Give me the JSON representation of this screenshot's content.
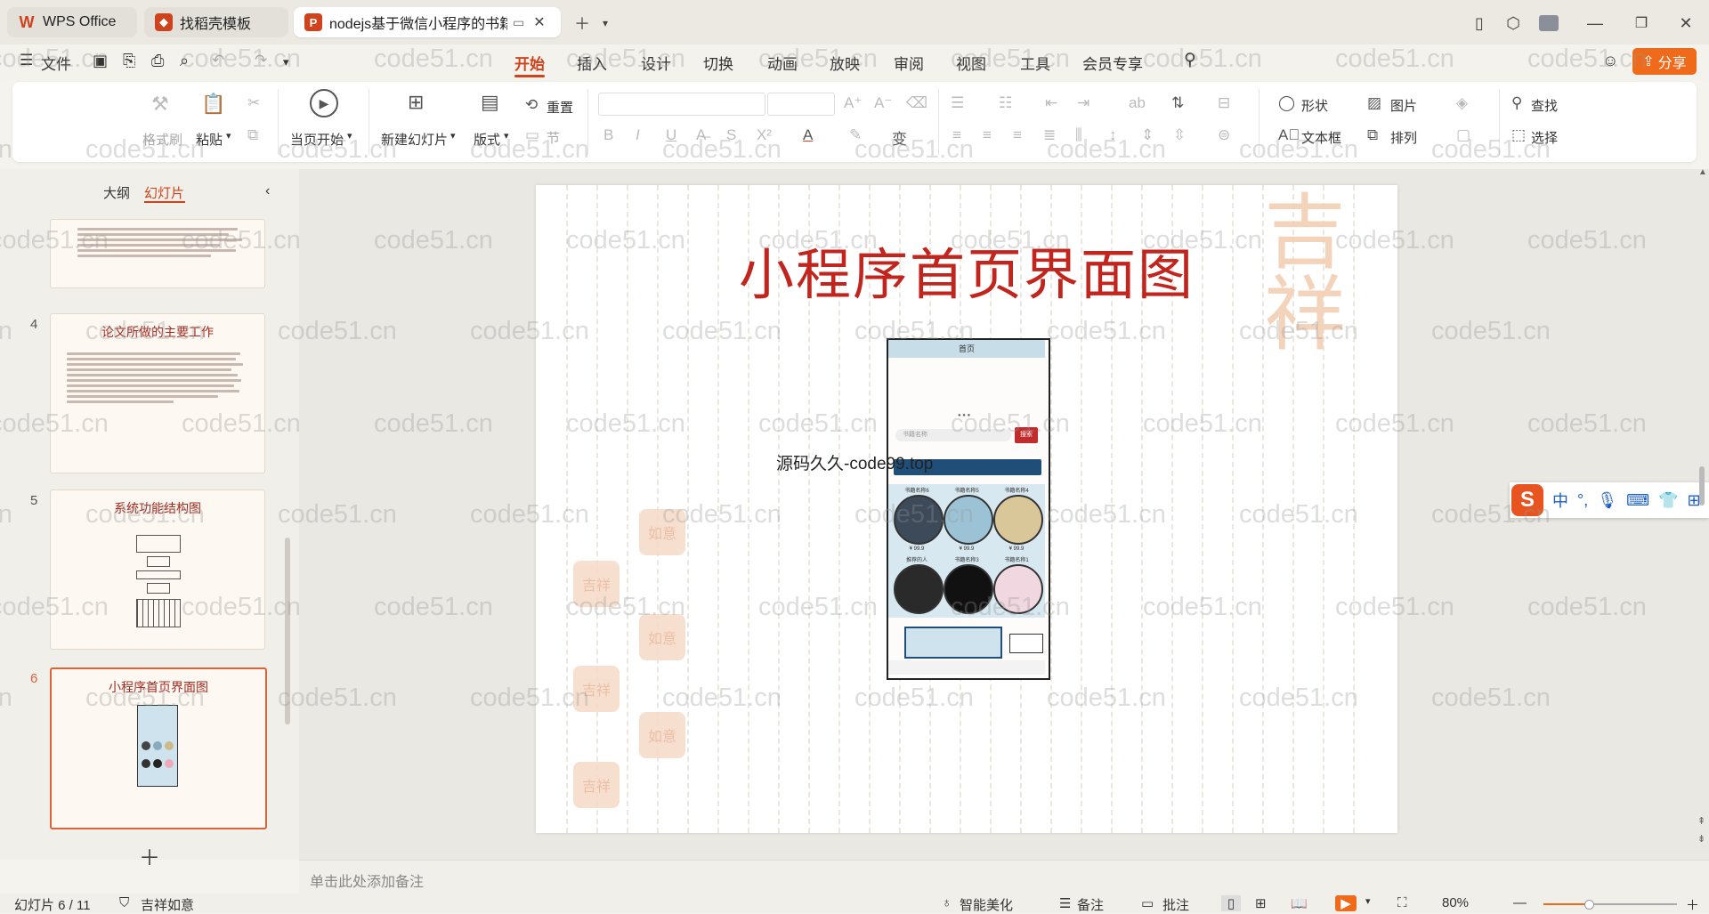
{
  "tabs": [
    {
      "label": "WPS Office"
    },
    {
      "label": "找稻壳模板"
    },
    {
      "label": "nodejs基于微信小程序的书籍"
    }
  ],
  "menu": {
    "file": "文件",
    "items": [
      "开始",
      "插入",
      "设计",
      "切换",
      "动画",
      "放映",
      "审阅",
      "视图",
      "工具",
      "会员专享"
    ],
    "share": "分享"
  },
  "ribbon": {
    "format_painter": "格式刷",
    "paste": "粘贴",
    "play_from_current": "当页开始",
    "new_slide": "新建幻灯片",
    "layout": "版式",
    "section": "节",
    "reset": "重置",
    "shape": "形状",
    "picture": "图片",
    "textbox": "文本框",
    "arrange": "排列",
    "find": "查找",
    "select": "选择"
  },
  "left_panel": {
    "tab_outline": "大纲",
    "tab_slides": "幻灯片",
    "thumbs": [
      {
        "num": "4",
        "title": "论文所做的主要工作"
      },
      {
        "num": "5",
        "title": "系统功能结构图"
      },
      {
        "num": "6",
        "title": "小程序首页界面图"
      }
    ]
  },
  "slide": {
    "title": "小程序首页界面图",
    "phone_header": "首页",
    "phone_search_placeholder": "书籍名称",
    "phone_search_btn": "搜索",
    "overlay_text": "源码久久-code99.top",
    "book_labels": [
      "书籍名称6",
      "书籍名称5",
      "书籍名称4",
      "推荐的人",
      "书籍名称3",
      "书籍名称1"
    ],
    "book_price": "¥ 99.9"
  },
  "notes_placeholder": "单击此处添加备注",
  "status": {
    "slide_index": "幻灯片 6 / 11",
    "theme": "吉祥如意",
    "beautify": "智能美化",
    "notes": "备注",
    "comments": "批注",
    "zoom": "80%"
  },
  "watermark_text": "code51.cn",
  "colors": {
    "accent": "#d0421b",
    "share": "#ef6a1a",
    "title_red": "#c1251d"
  }
}
